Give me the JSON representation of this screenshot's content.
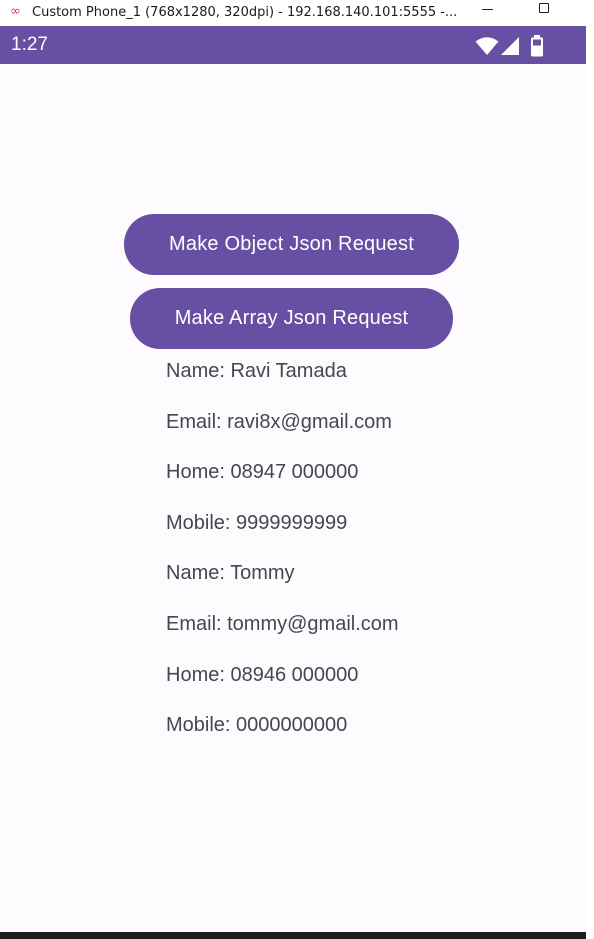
{
  "window": {
    "title": "Custom Phone_1 (768x1280, 320dpi) - 192.168.140.101:5555 -..."
  },
  "statusbar": {
    "time": "1:27",
    "icons": [
      "wifi-icon",
      "signal-icon",
      "battery-icon"
    ]
  },
  "buttons": {
    "object_label": "Make Object Json Request",
    "array_label": "Make Array Json Request"
  },
  "results": [
    "Name: Ravi Tamada",
    "Email: ravi8x@gmail.com",
    "Home: 08947 000000",
    "Mobile: 9999999999",
    "Name: Tommy",
    "Email: tommy@gmail.com",
    "Home: 08946 000000",
    "Mobile: 0000000000"
  ],
  "colors": {
    "primary": "#6750a4",
    "background": "#fefbff",
    "text": "#49454f",
    "on_primary": "#ffffff"
  }
}
